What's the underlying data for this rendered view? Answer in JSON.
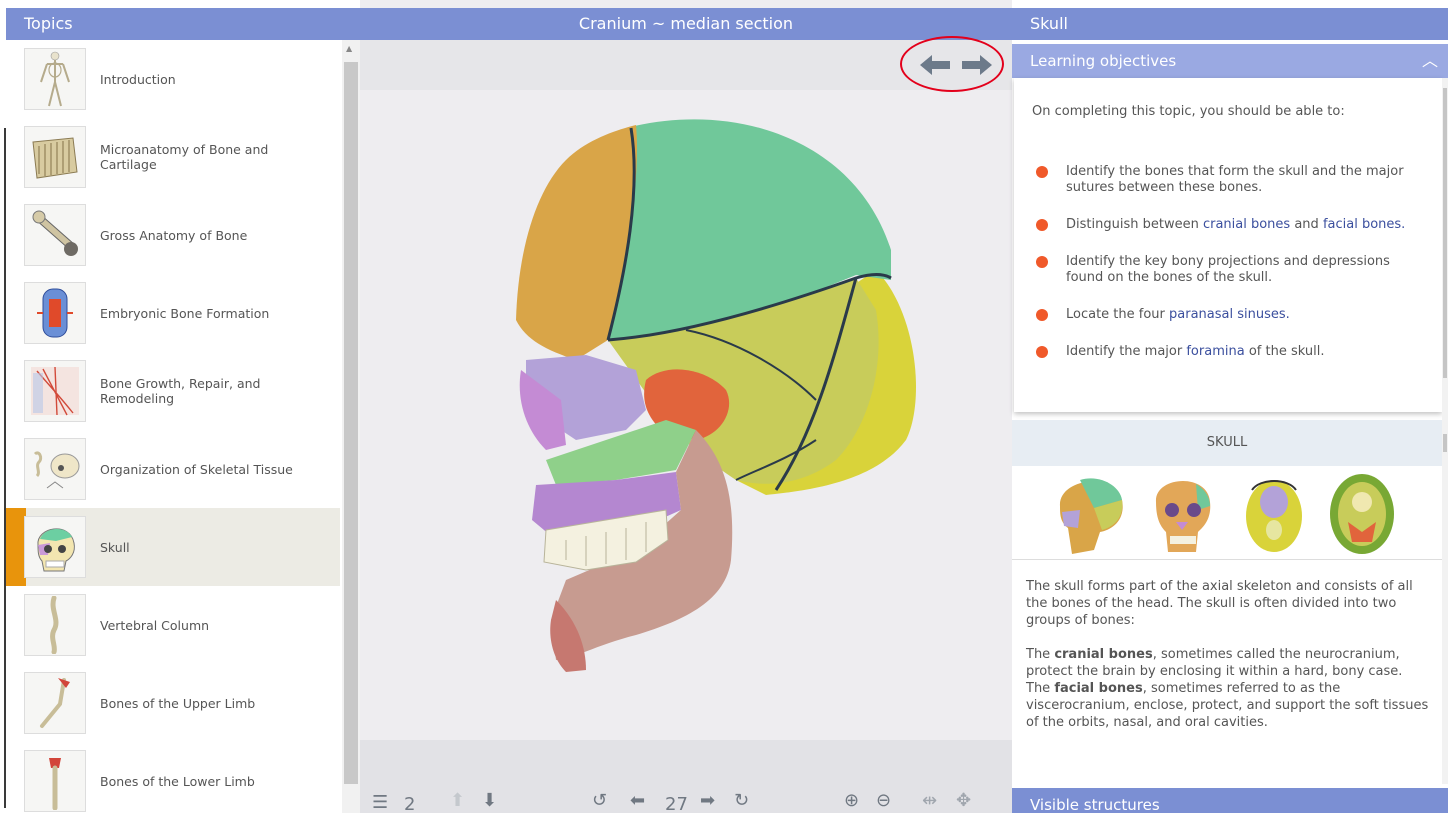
{
  "left": {
    "header": "Topics",
    "topics": [
      {
        "label": "Introduction",
        "icon": "skeleton-thumbnail"
      },
      {
        "label": "Microanatomy of Bone and Cartilage",
        "icon": "bone-tissue-thumbnail"
      },
      {
        "label": "Gross Anatomy of Bone",
        "icon": "long-bone-thumbnail"
      },
      {
        "label": "Embryonic Bone Formation",
        "icon": "embryonic-bone-thumbnail"
      },
      {
        "label": "Bone Growth, Repair, and Remodeling",
        "icon": "bone-growth-thumbnail"
      },
      {
        "label": "Organization of Skeletal Tissue",
        "icon": "skeletal-organization-thumbnail"
      },
      {
        "label": "Skull",
        "icon": "skull-thumbnail",
        "active": true
      },
      {
        "label": "Vertebral Column",
        "icon": "vertebral-column-thumbnail"
      },
      {
        "label": "Bones of the Upper Limb",
        "icon": "upper-limb-thumbnail"
      },
      {
        "label": "Bones of the Lower Limb",
        "icon": "lower-limb-thumbnail"
      }
    ]
  },
  "center": {
    "header": "Cranium ~ median section",
    "nav": {
      "back_icon": "arrow-left-icon",
      "forward_icon": "arrow-right-icon"
    },
    "bottom_bar": {
      "layer_count": "2",
      "page_number": "27"
    }
  },
  "right": {
    "header": "Skull",
    "objectives": {
      "title": "Learning objectives",
      "intro": "On completing this topic, you should be able to:",
      "items": [
        {
          "pre": "Identify the bones that form the skull and the major sutures between these bones.",
          "k1": "",
          "mid": "",
          "k2": "",
          "post": ""
        },
        {
          "pre": "Distinguish between ",
          "k1": "cranial bones",
          "mid": " and ",
          "k2": "facial bones",
          "post": "."
        },
        {
          "pre": "Identify the key bony projections and depressions found on the bones of the skull.",
          "k1": "",
          "mid": "",
          "k2": "",
          "post": ""
        },
        {
          "pre": "Locate the four ",
          "k1": "paranasal sinuses",
          "mid": ".",
          "k2": "",
          "post": ""
        },
        {
          "pre": "Identify the major ",
          "k1": "foramina",
          "mid": " of the skull.",
          "k2": "",
          "post": ""
        }
      ]
    },
    "section_title": "SKULL",
    "description": {
      "p1": "The skull forms part of the axial skeleton and consists of all the bones of the head. The skull is often divided into two groups of bones:",
      "p2_pre": "The ",
      "p2_bold": "cranial bones",
      "p2_post": ", sometimes called the neurocranium, protect the brain by enclosing it within a hard, bony case.",
      "p3_pre": "The ",
      "p3_bold": "facial bones",
      "p3_post": ", sometimes referred to as the viscerocranium, enclose, protect, and support the soft tissues of the orbits, nasal, and oral cavities."
    },
    "visible_structures": "Visible structures"
  },
  "colors": {
    "header_blue": "#7b8fd3",
    "objectives_blue": "#9aa9e2",
    "bullet_orange": "#f0592a",
    "active_orange": "#e8940c",
    "keyword_blue": "#3b4f9e"
  }
}
